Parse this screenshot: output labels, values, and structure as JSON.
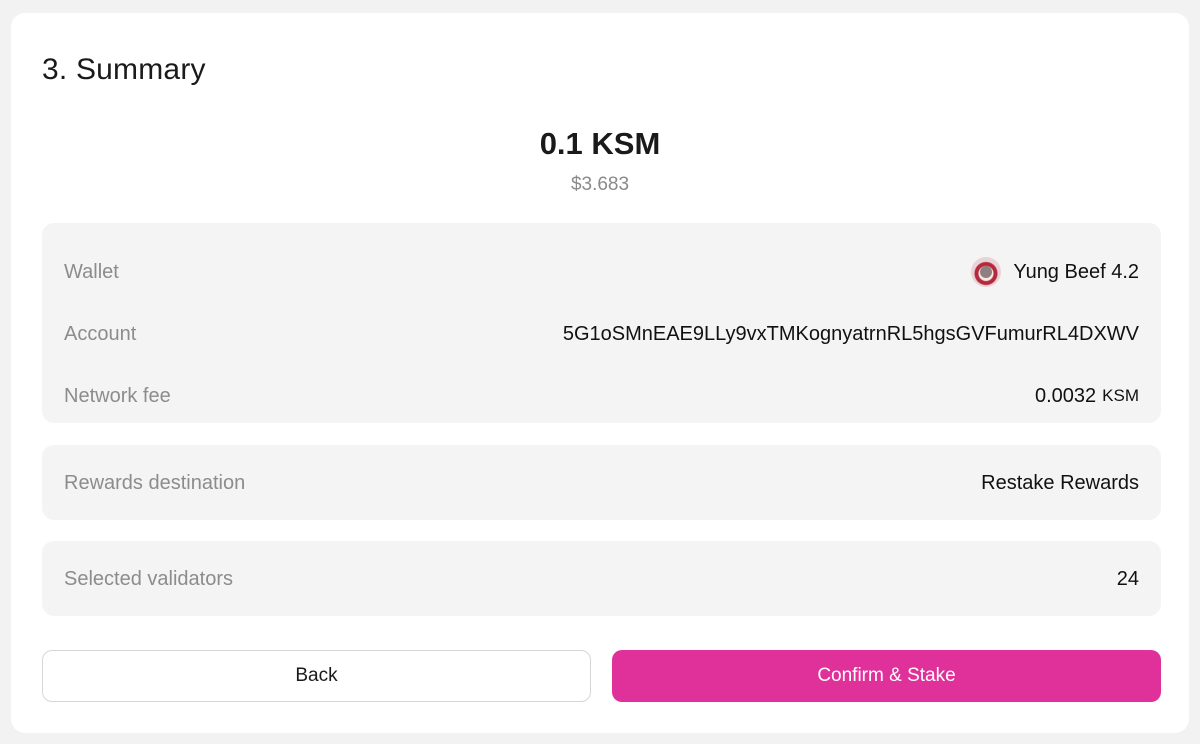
{
  "summary": {
    "title": "3. Summary",
    "amount": "0.1 KSM",
    "amount_usd": "$3.683"
  },
  "details": {
    "wallet_label": "Wallet",
    "wallet_value": "Yung Beef 4.2",
    "wallet_avatar_icon": "wallet-avatar-icon",
    "account_label": "Account",
    "account_value": "5G1oSMnEAE9LLy9vxTMKognyatrnRL5hgsGVFumurRL4DXWV",
    "fee_label": "Network fee",
    "fee_value": "0.0032",
    "fee_unit": "KSM"
  },
  "rewards": {
    "label": "Rewards destination",
    "value": "Restake Rewards"
  },
  "validators": {
    "label": "Selected validators",
    "value": "24"
  },
  "actions": {
    "back_label": "Back",
    "confirm_label": "Confirm & Stake"
  },
  "colors": {
    "accent": "#e0309a",
    "panel_bg": "#f4f4f4",
    "label_text": "#8c8c8c"
  }
}
